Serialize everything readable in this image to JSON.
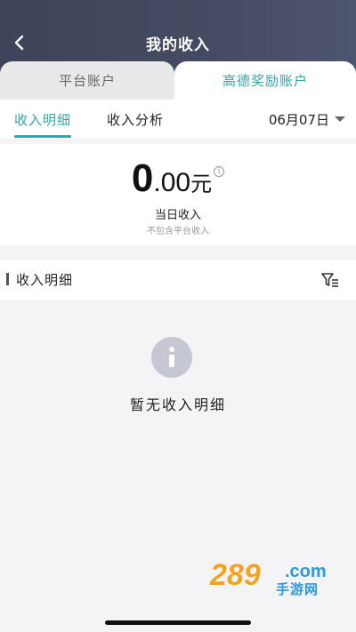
{
  "header": {
    "title": "我的收入"
  },
  "account_tabs": [
    {
      "label": "平台账户"
    },
    {
      "label": "高德奖励账户"
    }
  ],
  "sub_tabs": [
    {
      "label": "收入明细"
    },
    {
      "label": "收入分析"
    }
  ],
  "date_filter": {
    "value": "06月07日"
  },
  "summary": {
    "amount_integer": "0",
    "amount_decimal": ".00",
    "unit": "元",
    "label": "当日收入",
    "note": "不包含平台收入"
  },
  "detail_section": {
    "title": "收入明细"
  },
  "empty_state": {
    "text": "暂无收入明细"
  },
  "watermark": {
    "number": "289",
    "suffix": ".com",
    "sub": "手游网"
  },
  "colors": {
    "accent": "#2fa7a8",
    "header_bg": "#454b62",
    "page_bg": "#f4f4f6"
  }
}
